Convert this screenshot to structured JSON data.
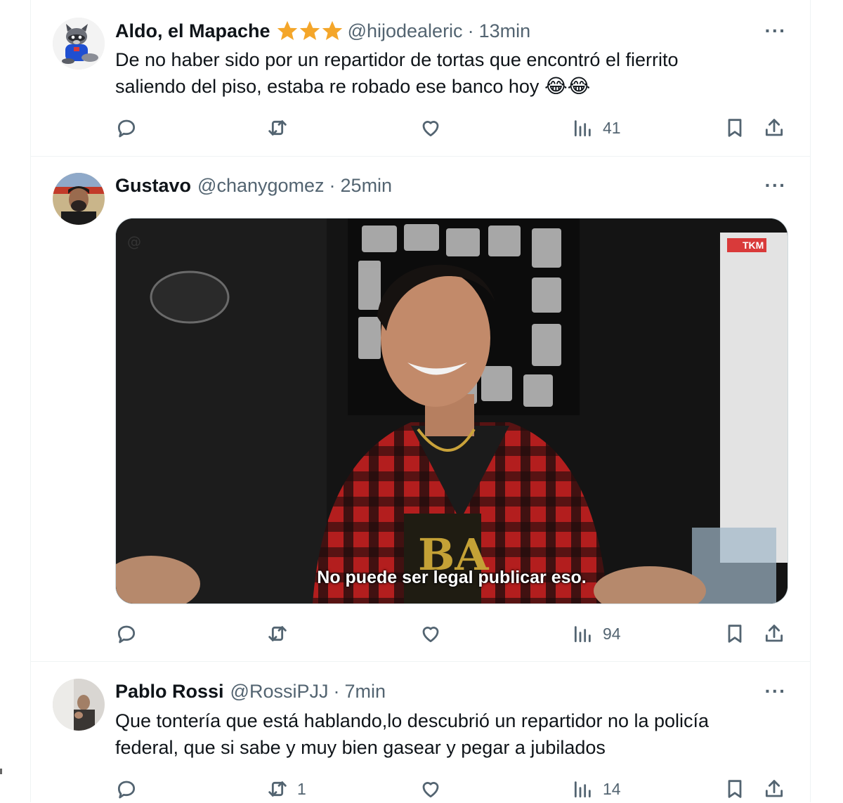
{
  "tweets": [
    {
      "name": "Aldo, el Mapache",
      "badge_icons": [
        "star-icon",
        "star-icon",
        "star-icon"
      ],
      "handle": "@hijodealeric",
      "separator": "·",
      "time": "13min",
      "more_label": "···",
      "text_line1": "De no haber sido por un repartidor de tortas que encontró el fierrito",
      "text_line2": "saliendo del piso, estaba re robado ese banco hoy",
      "emoji": "😂😂",
      "actions": {
        "reply": "",
        "retweet": "",
        "like": "",
        "views": "41"
      }
    },
    {
      "name": "Gustavo",
      "handle": "@chanygomez",
      "separator": "·",
      "time": "25min",
      "more_label": "···",
      "media_caption": "No puede ser legal publicar eso.",
      "media_watermark": "TKM",
      "actions": {
        "reply": "",
        "retweet": "",
        "like": "",
        "views": "94"
      }
    },
    {
      "name": "Pablo Rossi",
      "handle": "@RossiPJJ",
      "separator": "·",
      "time": "7min",
      "more_label": "···",
      "text_line1": "Que tontería que está hablando,lo descubrió un repartidor no la policía",
      "text_line2": "federal, que si sabe y muy bien gasear y pegar a jubilados",
      "actions": {
        "reply": "",
        "retweet": "1",
        "like": "",
        "views": "14"
      }
    }
  ],
  "colors": {
    "text": "#0f1419",
    "muted": "#536471",
    "border": "#eff3f4",
    "star": "#f4a62a"
  }
}
